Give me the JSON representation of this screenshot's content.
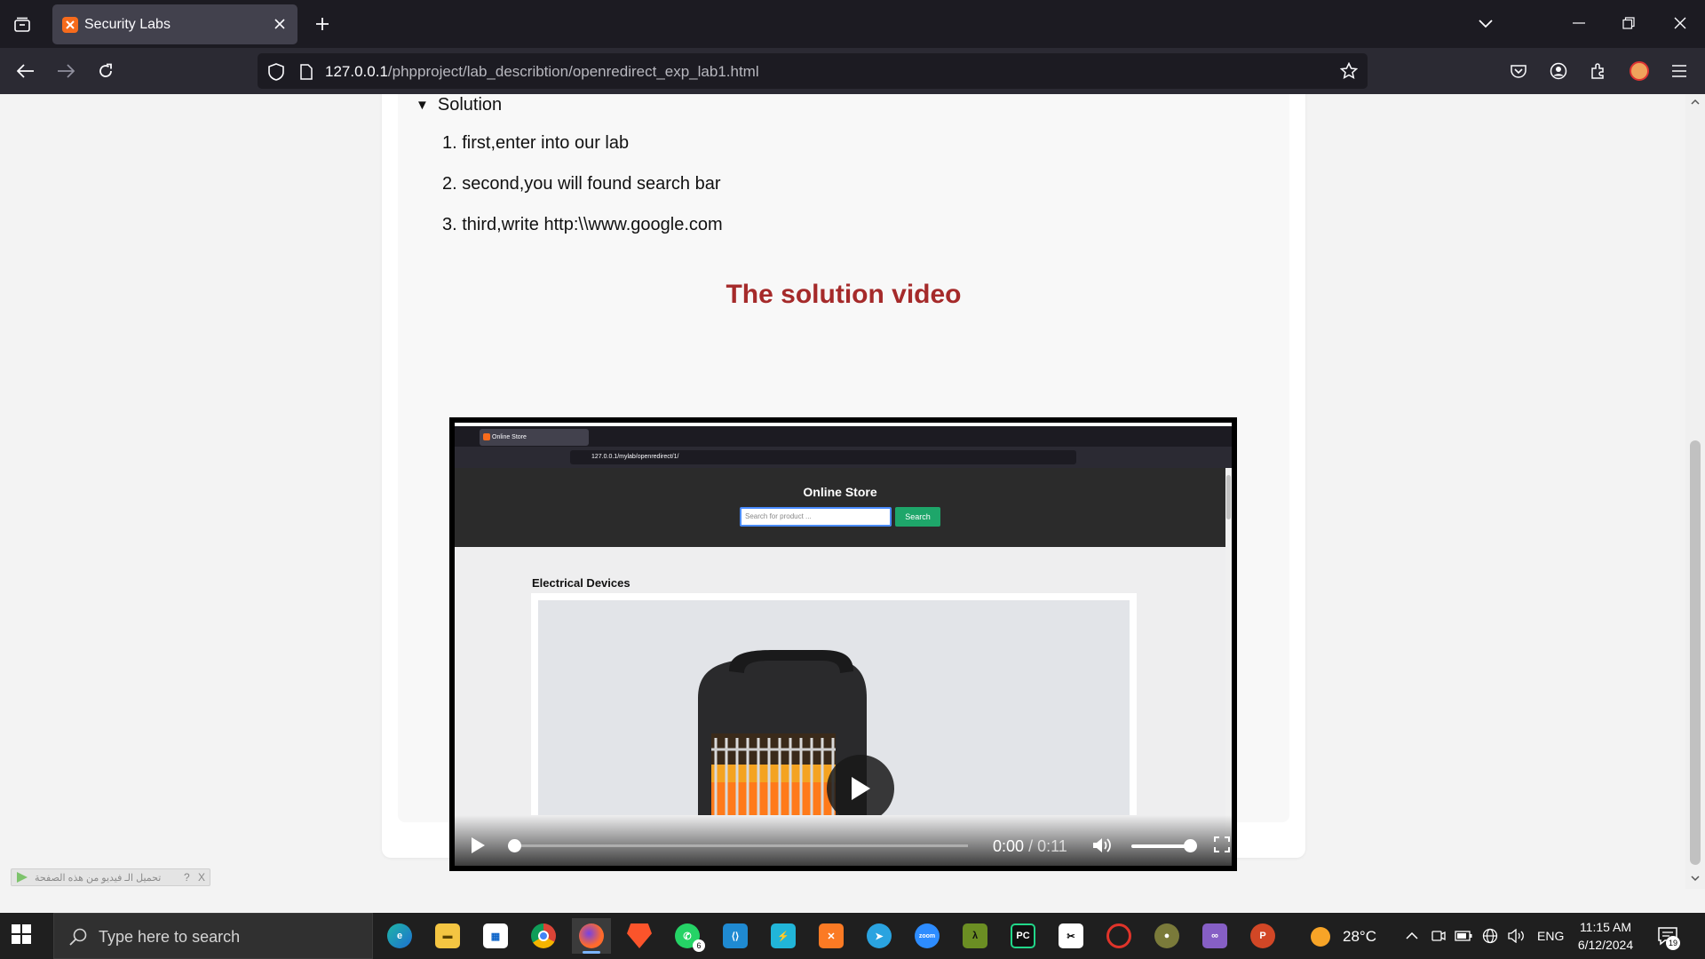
{
  "browser": {
    "tab_title": "Security Labs",
    "url_host": "127.0.0.1",
    "url_path": "/phpproject/lab_describtion/openredirect_exp_lab1.html"
  },
  "page": {
    "summary_label": "Solution",
    "steps": [
      "1. first,enter into our lab",
      "2. second,you will found search bar",
      "3. third,write http:\\\\www.google.com"
    ],
    "video_heading": "The solution video",
    "heading_color": "#a52a2a"
  },
  "video": {
    "inner_tab_title": "Online Store",
    "inner_url": "127.0.0.1/mylab/openredirect/1/",
    "store_title": "Online Store",
    "search_placeholder": "Search for product ...",
    "search_button": "Search",
    "section_title": "Electrical Devices",
    "time_current": "0:00",
    "time_separator": "/",
    "time_total": "0:11",
    "progress_fraction": 0.0,
    "volume_fraction": 0.85
  },
  "helper_bar": {
    "text": "تحميل الـ فيديو من هذه الصفحة",
    "help": "?",
    "close": "X"
  },
  "taskbar": {
    "search_placeholder": "Type here to search",
    "weather": "28°C",
    "language": "ENG",
    "time": "11:15 AM",
    "date": "6/12/2024",
    "notification_count": "19",
    "whatsapp_badge": "6",
    "apps": [
      "edge-icon",
      "file-explorer-icon",
      "microsoft-store-icon",
      "chrome-icon",
      "firefox-icon",
      "brave-icon",
      "whatsapp-icon",
      "vscode-icon",
      "app-bolt-icon",
      "xampp-icon",
      "telegram-icon",
      "zoom-icon",
      "lambda-app-icon",
      "pycharm-icon",
      "capcut-icon",
      "recorder-icon",
      "app-ball-icon",
      "visual-studio-icon",
      "powerpoint-icon"
    ]
  }
}
